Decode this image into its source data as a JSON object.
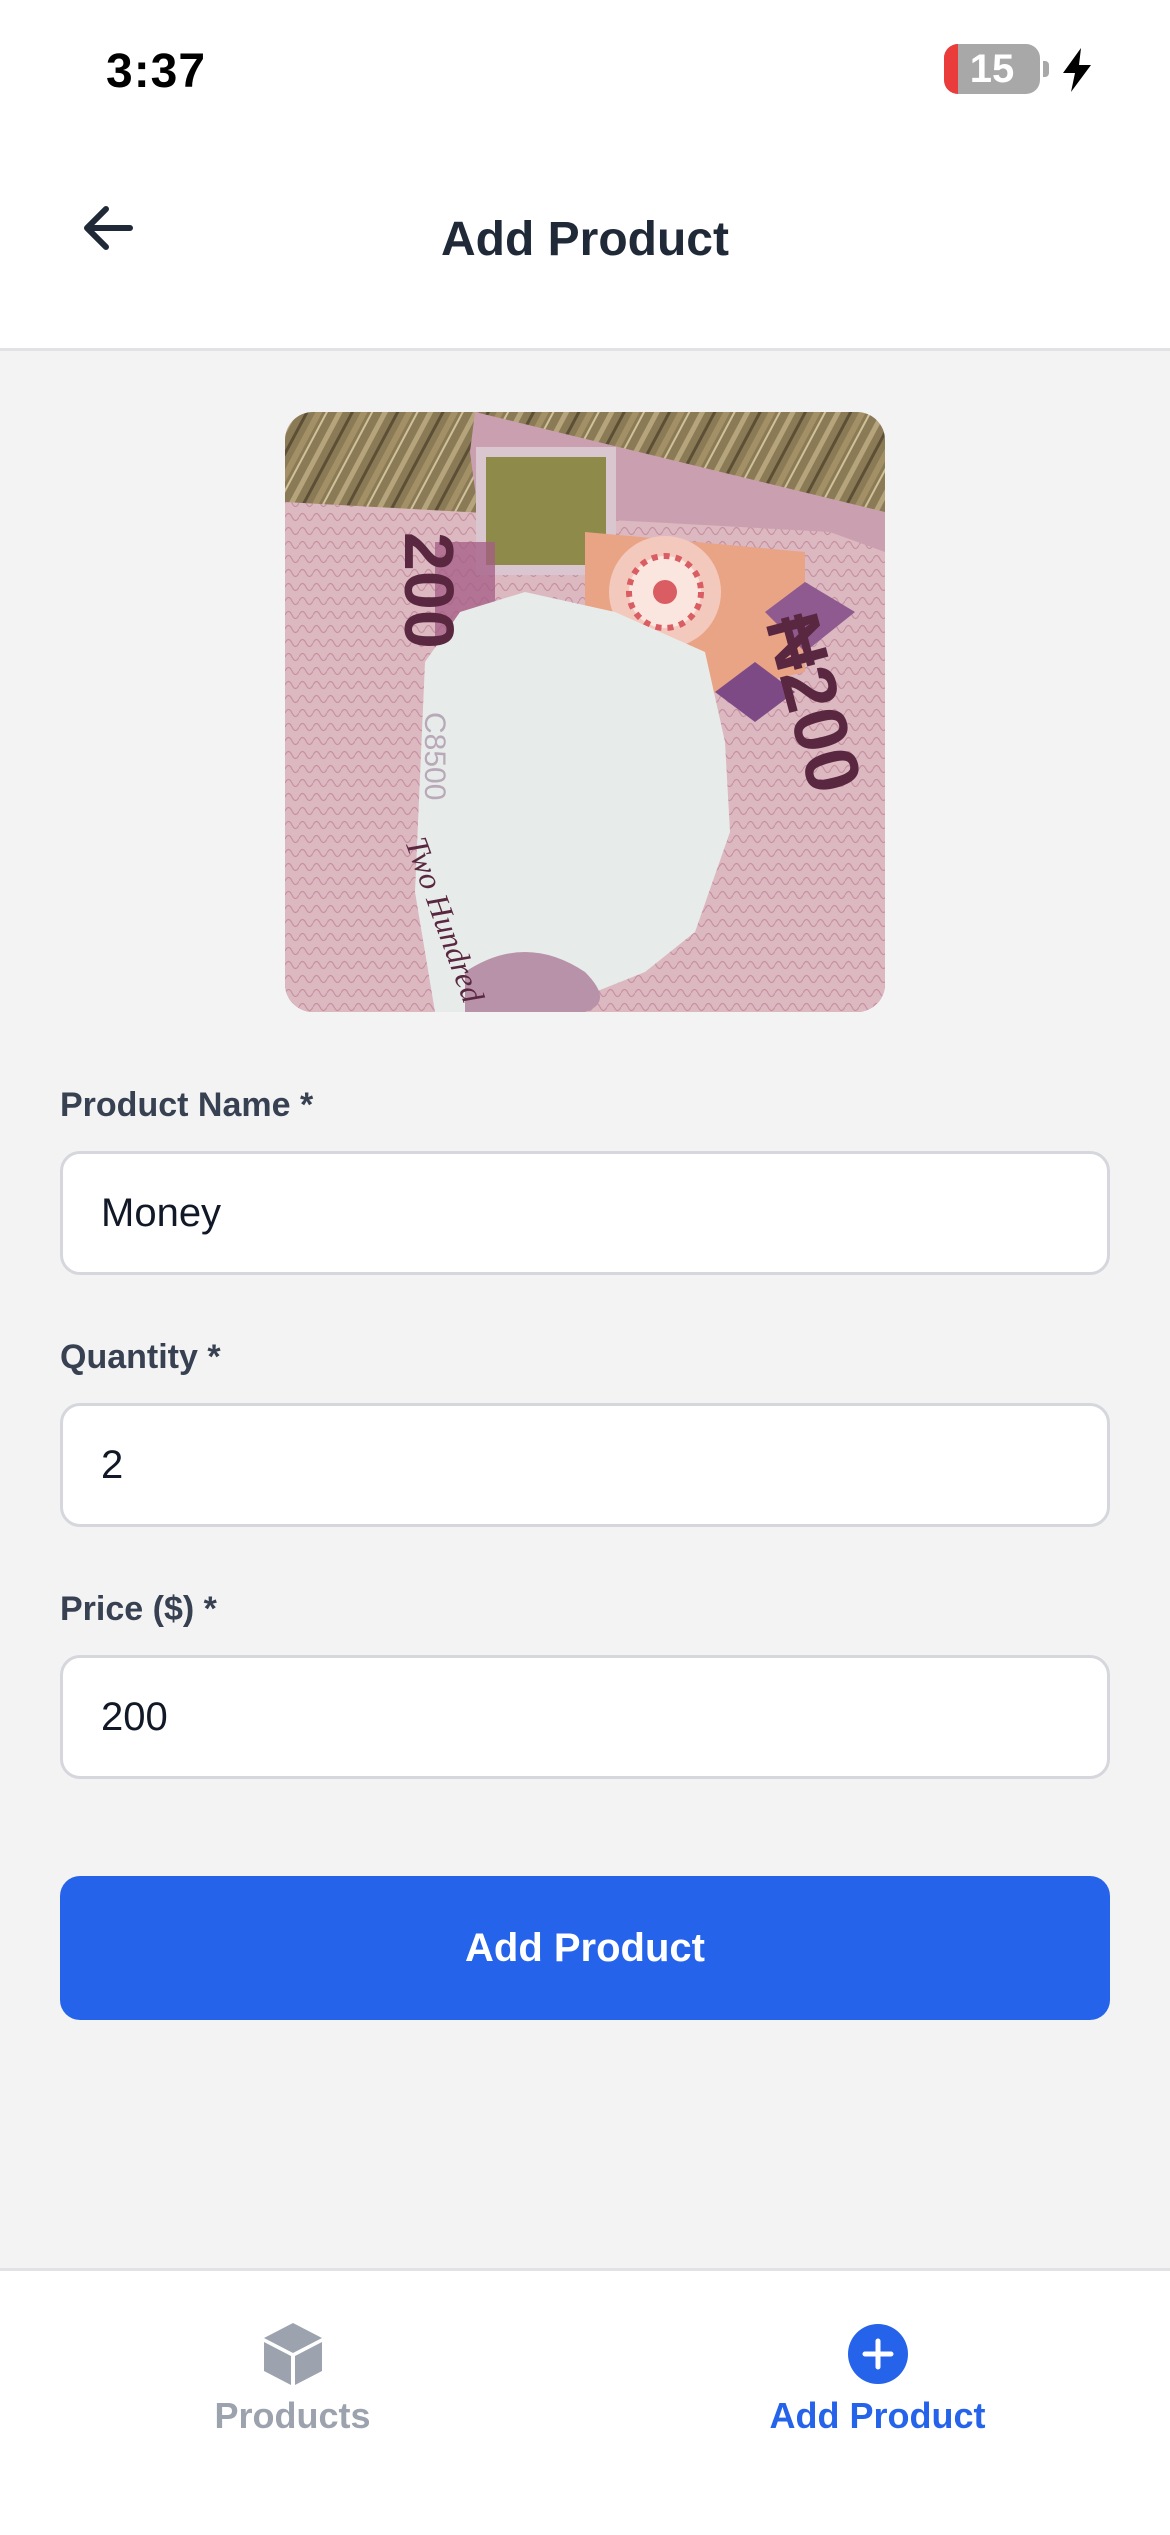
{
  "status_bar": {
    "time": "3:37",
    "battery_level": "15",
    "battery_fraction": 0.15,
    "charging_icon": "bolt-icon"
  },
  "header": {
    "title": "Add Product",
    "back_icon": "arrow-left-icon"
  },
  "product_image": {
    "note_denomination": "₦200",
    "note_value_small": "200",
    "note_text_script": "Two Hundred",
    "note_serial": "C8500"
  },
  "form": {
    "name_label": "Product Name *",
    "name_value": "Money",
    "quantity_label": "Quantity *",
    "quantity_value": "2",
    "price_label": "Price ($) *",
    "price_value": "200",
    "submit_label": "Add Product"
  },
  "tab_bar": {
    "tabs": [
      {
        "label": "Products",
        "icon": "cube-icon",
        "active": false
      },
      {
        "label": "Add Product",
        "icon": "plus-circle-icon",
        "active": true
      }
    ]
  },
  "colors": {
    "accent": "#2563eb",
    "background": "#f3f3f4",
    "inactive_tab": "#9ca3af",
    "battery_low": "#eb3c3c"
  }
}
